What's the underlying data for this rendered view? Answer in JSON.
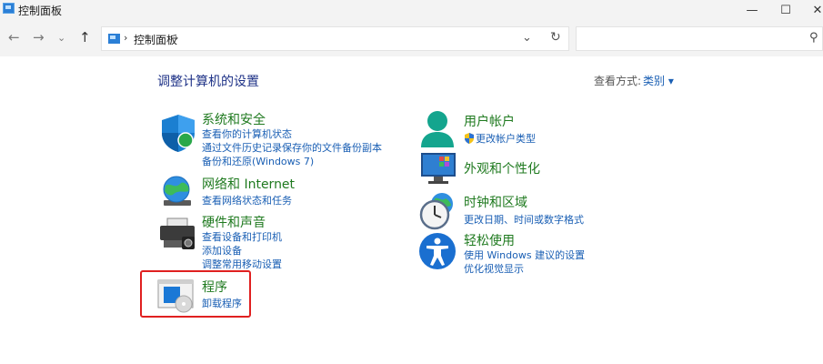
{
  "window": {
    "title": "控制面板",
    "minimize": "—",
    "maximize": "☐",
    "close": "✕"
  },
  "nav": {
    "back": "←",
    "forward": "→",
    "recent": "⌄",
    "up": "↑"
  },
  "address": {
    "sep": "›",
    "location": "控制面板",
    "dropdown": "⌄",
    "refresh": "↻"
  },
  "search": {
    "placeholder": "",
    "icon": "⚲"
  },
  "header": {
    "title": "调整计算机的设置",
    "view_by_label": "查看方式:",
    "view_by_value": "类别 ▾"
  },
  "categories": [
    {
      "title": "系统和安全",
      "links": [
        "查看你的计算机状态",
        "通过文件历史记录保存你的文件备份副本",
        "备份和还原(Windows 7)"
      ],
      "icon": "shield-icon"
    },
    {
      "title": "网络和 Internet",
      "links": [
        "查看网络状态和任务"
      ],
      "icon": "globe-network-icon"
    },
    {
      "title": "硬件和声音",
      "links": [
        "查看设备和打印机",
        "添加设备",
        "调整常用移动设置"
      ],
      "icon": "printer-icon"
    },
    {
      "title": "程序",
      "links": [
        "卸载程序"
      ],
      "icon": "programs-disc-icon"
    },
    {
      "title": "用户帐户",
      "links": [
        "更改帐户类型"
      ],
      "icon": "user-icon"
    },
    {
      "title": "外观和个性化",
      "links": [],
      "icon": "monitor-icon"
    },
    {
      "title": "时钟和区域",
      "links": [
        "更改日期、时间或数字格式"
      ],
      "icon": "clock-globe-icon"
    },
    {
      "title": "轻松使用",
      "links": [
        "使用 Windows 建议的设置",
        "优化视觉显示"
      ],
      "icon": "accessibility-icon"
    }
  ],
  "colors": {
    "title_green": "#1f7a1f",
    "link_blue": "#1a5fb4",
    "heading_blue": "#1e3287",
    "highlight_red": "#e02020"
  }
}
